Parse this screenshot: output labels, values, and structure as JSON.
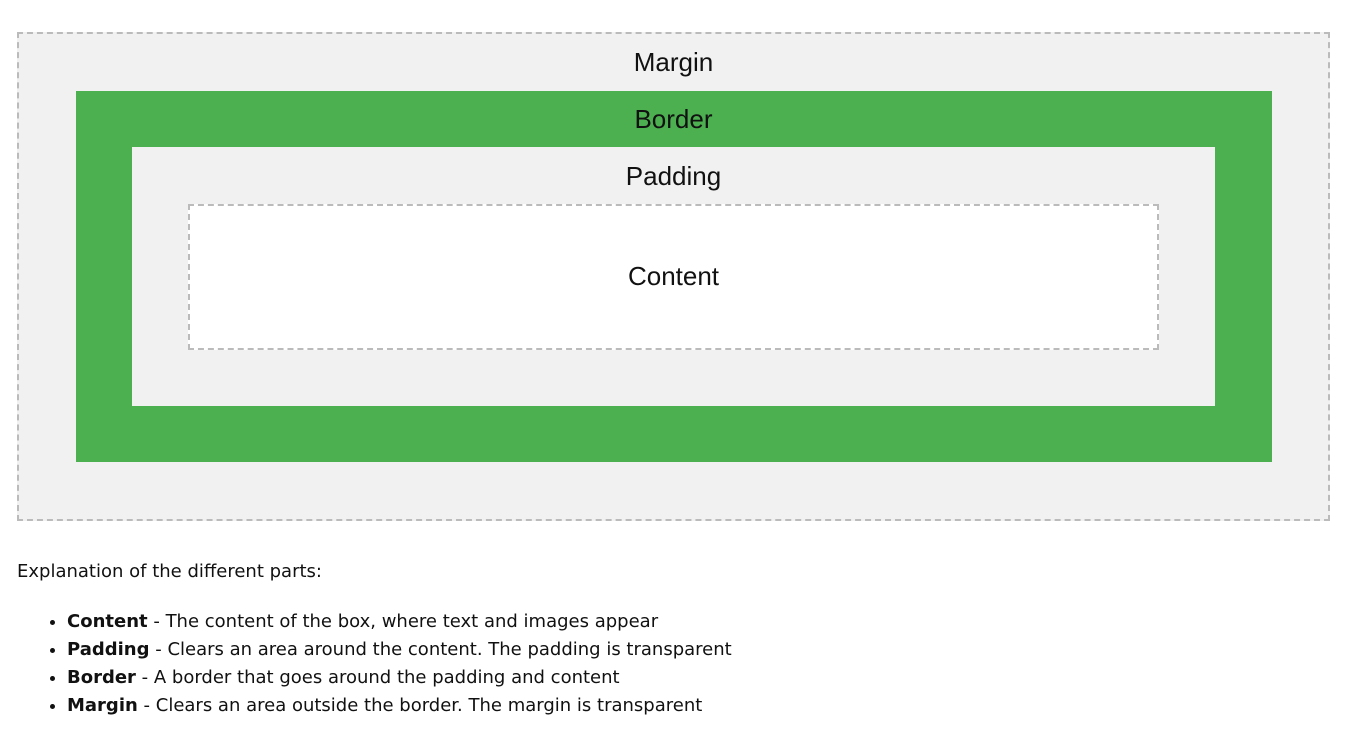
{
  "diagram": {
    "margin_label": "Margin",
    "border_label": "Border",
    "padding_label": "Padding",
    "content_label": "Content",
    "colors": {
      "margin": "#f1f1f1",
      "border": "#4caf50",
      "padding": "#f1f1f1",
      "content": "#ffffff",
      "dashed_outline": "#bbbbbb"
    }
  },
  "explanation": {
    "title": "Explanation of the different parts:",
    "items": [
      {
        "term": "Content",
        "description": " - The content of the box, where text and images appear"
      },
      {
        "term": "Padding",
        "description": " - Clears an area around the content. The padding is transparent"
      },
      {
        "term": "Border",
        "description": " - A border that goes around the padding and content"
      },
      {
        "term": "Margin",
        "description": " - Clears an area outside the border. The margin is transparent"
      }
    ]
  }
}
